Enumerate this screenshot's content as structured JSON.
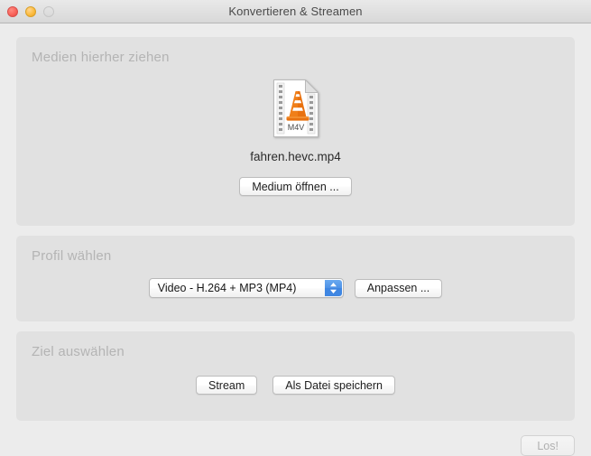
{
  "window": {
    "title": "Konvertieren & Streamen",
    "traffic_lights": [
      {
        "name": "close",
        "color": "#f9655c"
      },
      {
        "name": "minimize",
        "color": "#fcbc40"
      },
      {
        "name": "zoom",
        "color": "#dddddd"
      }
    ]
  },
  "media_panel": {
    "title": "Medien hierher ziehen",
    "file_icon_label": "M4V",
    "file_name": "fahren.hevc.mp4",
    "open_button": "Medium öffnen ..."
  },
  "profile_panel": {
    "title": "Profil wählen",
    "selected_profile": "Video - H.264 + MP3 (MP4)",
    "customize_button": "Anpassen ..."
  },
  "destination_panel": {
    "title": "Ziel auswählen",
    "stream_button": "Stream",
    "save_file_button": "Als Datei speichern"
  },
  "footer": {
    "go_button": "Los!",
    "go_button_enabled": false
  },
  "colors": {
    "window_background": "#ececec",
    "panel_background": "#e1e1e1",
    "panel_title": "#b4b4b4",
    "accent_blue": "#3f86e2",
    "cone_orange": "#e8710f"
  }
}
